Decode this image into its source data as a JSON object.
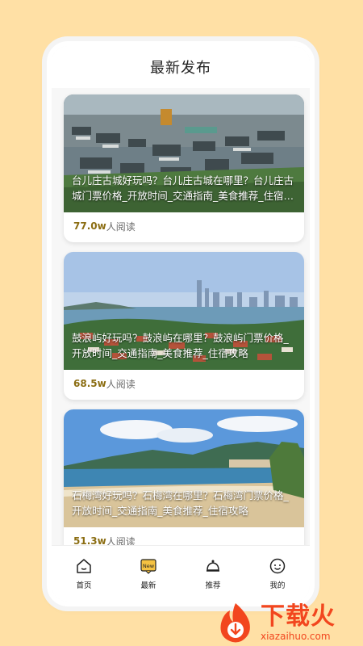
{
  "header": {
    "title": "最新发布"
  },
  "cards": [
    {
      "title": "台儿庄古城好玩吗？台儿庄古城在哪里？台儿庄古城门票价格_开放时间_交通指南_美食推荐_住宿攻略",
      "reads_count": "77.0w",
      "reads_unit": "人阅读"
    },
    {
      "title": "鼓浪屿好玩吗？鼓浪屿在哪里？鼓浪屿门票价格_开放时间_交通指南_美食推荐_住宿攻略",
      "reads_count": "68.5w",
      "reads_unit": "人阅读"
    },
    {
      "title": "石梅湾好玩吗？石梅湾在哪里？石梅湾门票价格_开放时间_交通指南_美食推荐_住宿攻略",
      "reads_count": "51.3w",
      "reads_unit": "人阅读"
    }
  ],
  "tabbar": {
    "items": [
      {
        "label": "首页",
        "icon": "home-icon"
      },
      {
        "label": "最新",
        "icon": "new-icon",
        "badge": "New"
      },
      {
        "label": "推荐",
        "icon": "bell-icon"
      },
      {
        "label": "我的",
        "icon": "profile-icon"
      }
    ]
  },
  "watermark": {
    "main": "下载火",
    "sub": "xiazaihuo.com"
  },
  "colors": {
    "background": "#FFE0A5",
    "accent": "#8B6D12",
    "brand": "#F2461E"
  }
}
